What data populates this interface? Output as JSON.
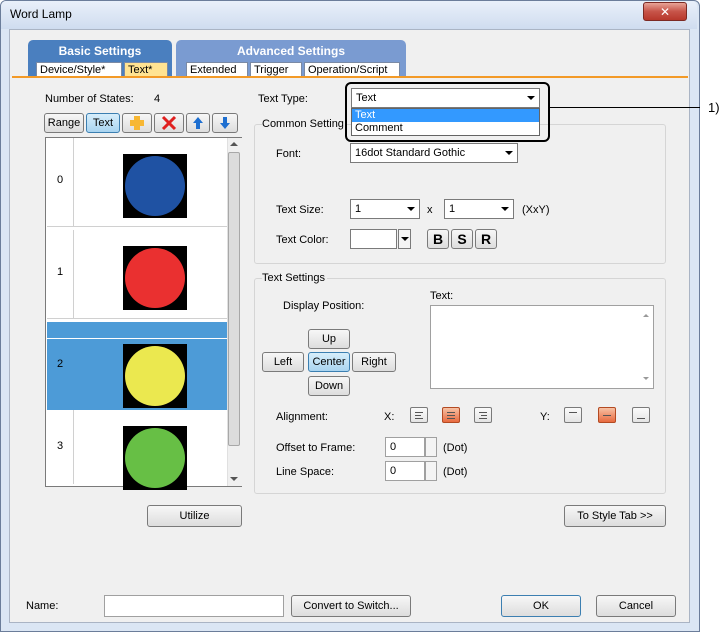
{
  "window": {
    "title": "Word Lamp",
    "close_symbol": "✕"
  },
  "tabs": {
    "basic": "Basic Settings",
    "advanced": "Advanced Settings",
    "sub": [
      "Device/Style*",
      "Text*",
      "Extended",
      "Trigger",
      "Operation/Script"
    ],
    "active_sub": "Text*"
  },
  "states": {
    "count_label": "Number of States:",
    "count_value": "4",
    "toolbar": {
      "range": "Range",
      "text": "Text"
    },
    "items": [
      {
        "num": "0",
        "color": "#1f52a3"
      },
      {
        "num": "1",
        "color": "#ea3030"
      },
      {
        "num": "2",
        "color": "#ebe84f",
        "selected": true
      },
      {
        "num": "3",
        "color": "#67bf45"
      }
    ],
    "selected_row_color": "#4d9bd7"
  },
  "text_type": {
    "label": "Text Type:",
    "value": "Text",
    "options": [
      "Text",
      "Comment"
    ],
    "highlighted": "Text"
  },
  "common": {
    "title": "Common Setting",
    "font_label": "Font:",
    "font_value": "16dot Standard Gothic",
    "size_label": "Text Size:",
    "size_w": "1",
    "size_x": "x",
    "size_h": "1",
    "size_unit": "(XxY)",
    "color_label": "Text Color:",
    "bold": "B",
    "shadow": "S",
    "raised": "R"
  },
  "text_settings": {
    "title": "Text Settings",
    "display_position": "Display Position:",
    "text_label": "Text:",
    "up": "Up",
    "left": "Left",
    "center": "Center",
    "right": "Right",
    "down": "Down",
    "alignment": "Alignment:",
    "x": "X:",
    "y": "Y:",
    "offset_label": "Offset to Frame:",
    "offset_value": "0",
    "offset_unit": "(Dot)",
    "line_space_label": "Line Space:",
    "line_space_value": "0",
    "line_space_unit": "(Dot)"
  },
  "buttons": {
    "utilize": "Utilize",
    "to_style": "To Style Tab >>",
    "convert": "Convert to Switch...",
    "ok": "OK",
    "cancel": "Cancel"
  },
  "name_label": "Name:",
  "callout": "1)",
  "colors": {
    "basic_tab": "#4a7fbf",
    "advanced_tab": "#7a9bd1",
    "highlight": "#3399ff",
    "callout_border": "#000000"
  }
}
